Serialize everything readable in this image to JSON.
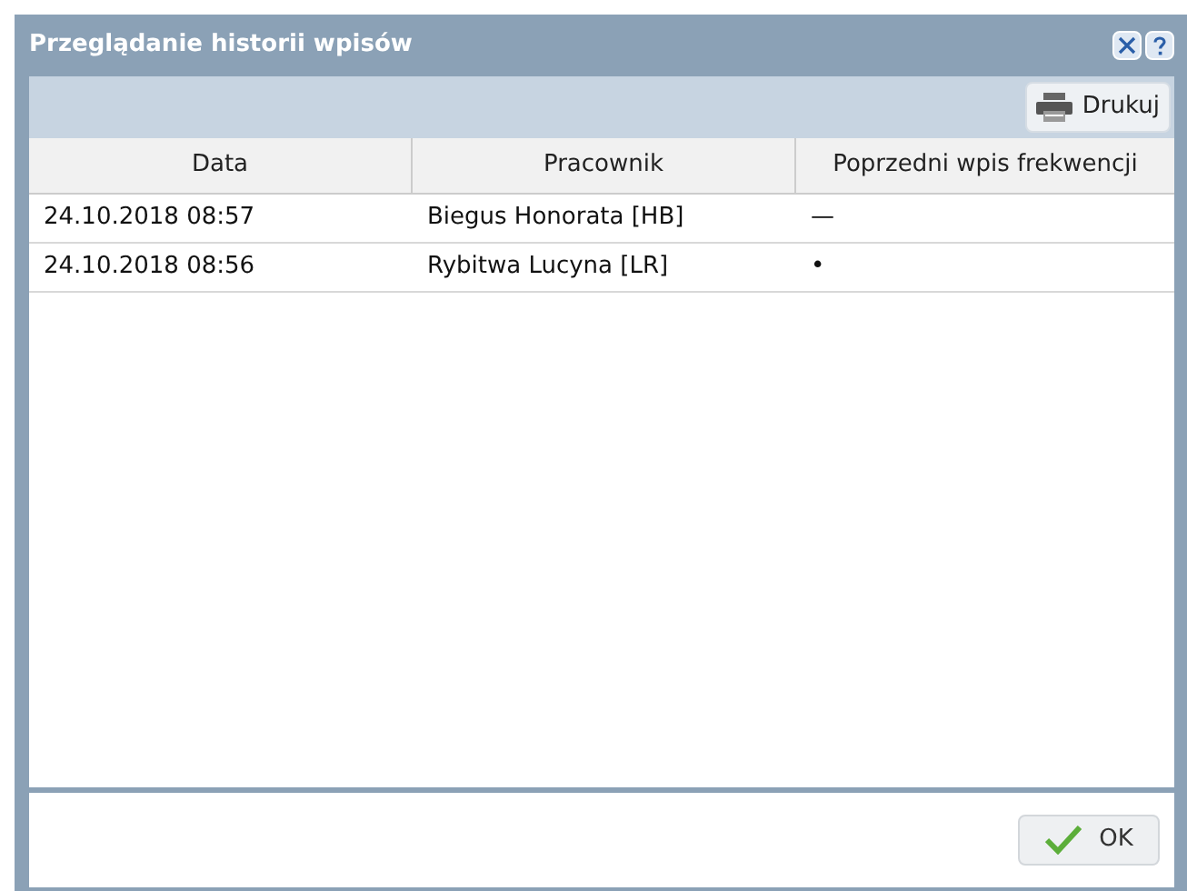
{
  "window": {
    "title": "Przeglądanie historii wpisów"
  },
  "toolbar": {
    "print_button": "Drukuj"
  },
  "table": {
    "columns": [
      "Data",
      "Pracownik",
      "Poprzedni wpis frekwencji"
    ],
    "rows": [
      [
        "24.10.2018 08:57",
        "Biegus Honorata [HB]",
        "—"
      ],
      [
        "24.10.2018 08:56",
        "Rybitwa Lucyna [LR]",
        "•"
      ]
    ]
  },
  "footer": {
    "ok_button": "OK"
  }
}
